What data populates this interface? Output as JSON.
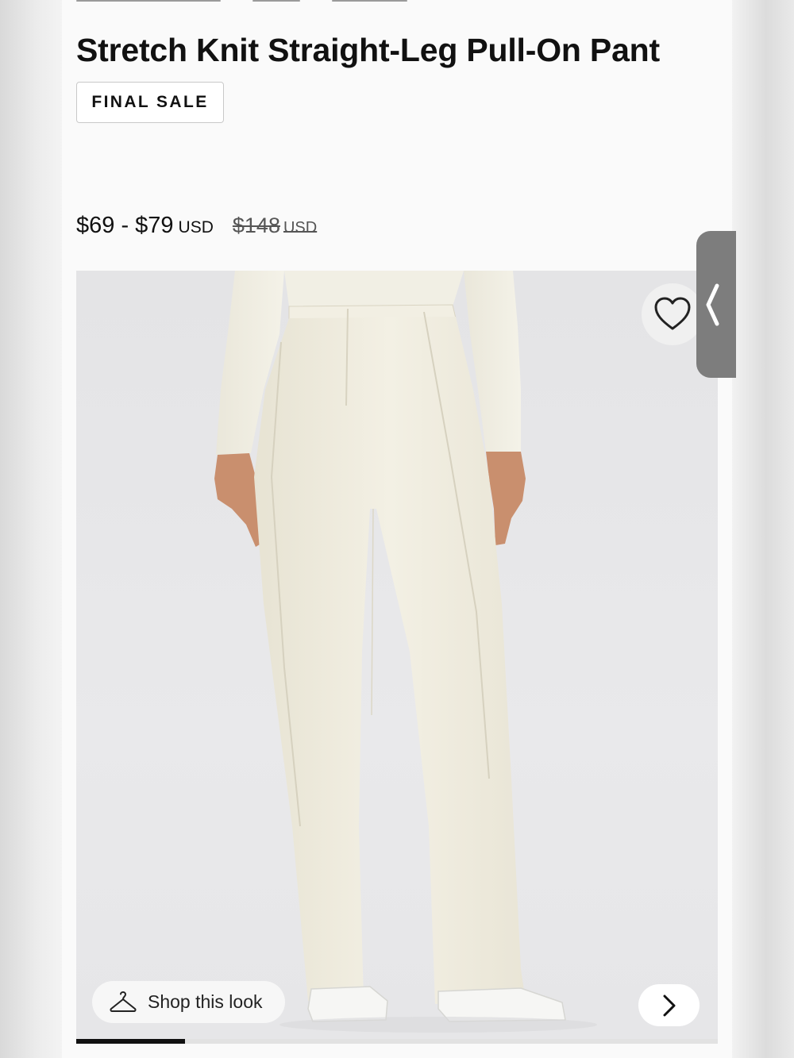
{
  "product": {
    "title": "Stretch Knit Straight-Leg Pull-On Pant",
    "badge": "FINAL SALE"
  },
  "price": {
    "range": "$69 - $79",
    "currency": "USD",
    "original": "$148",
    "original_currency": "USD"
  },
  "gallery": {
    "shop_look_label": "Shop this look",
    "shop_look_icon": "hanger-icon",
    "wishlist_icon": "heart-icon",
    "next_icon": "chevron-right-icon",
    "image_progress": 0.17
  },
  "side_tab": {
    "icon": "chevron-left-icon"
  },
  "colors": {
    "text": "#111111",
    "badge_border": "#c9c9c9",
    "side_tab": "#7d7d7d",
    "progress": "#111111",
    "garment": "#efece0"
  }
}
